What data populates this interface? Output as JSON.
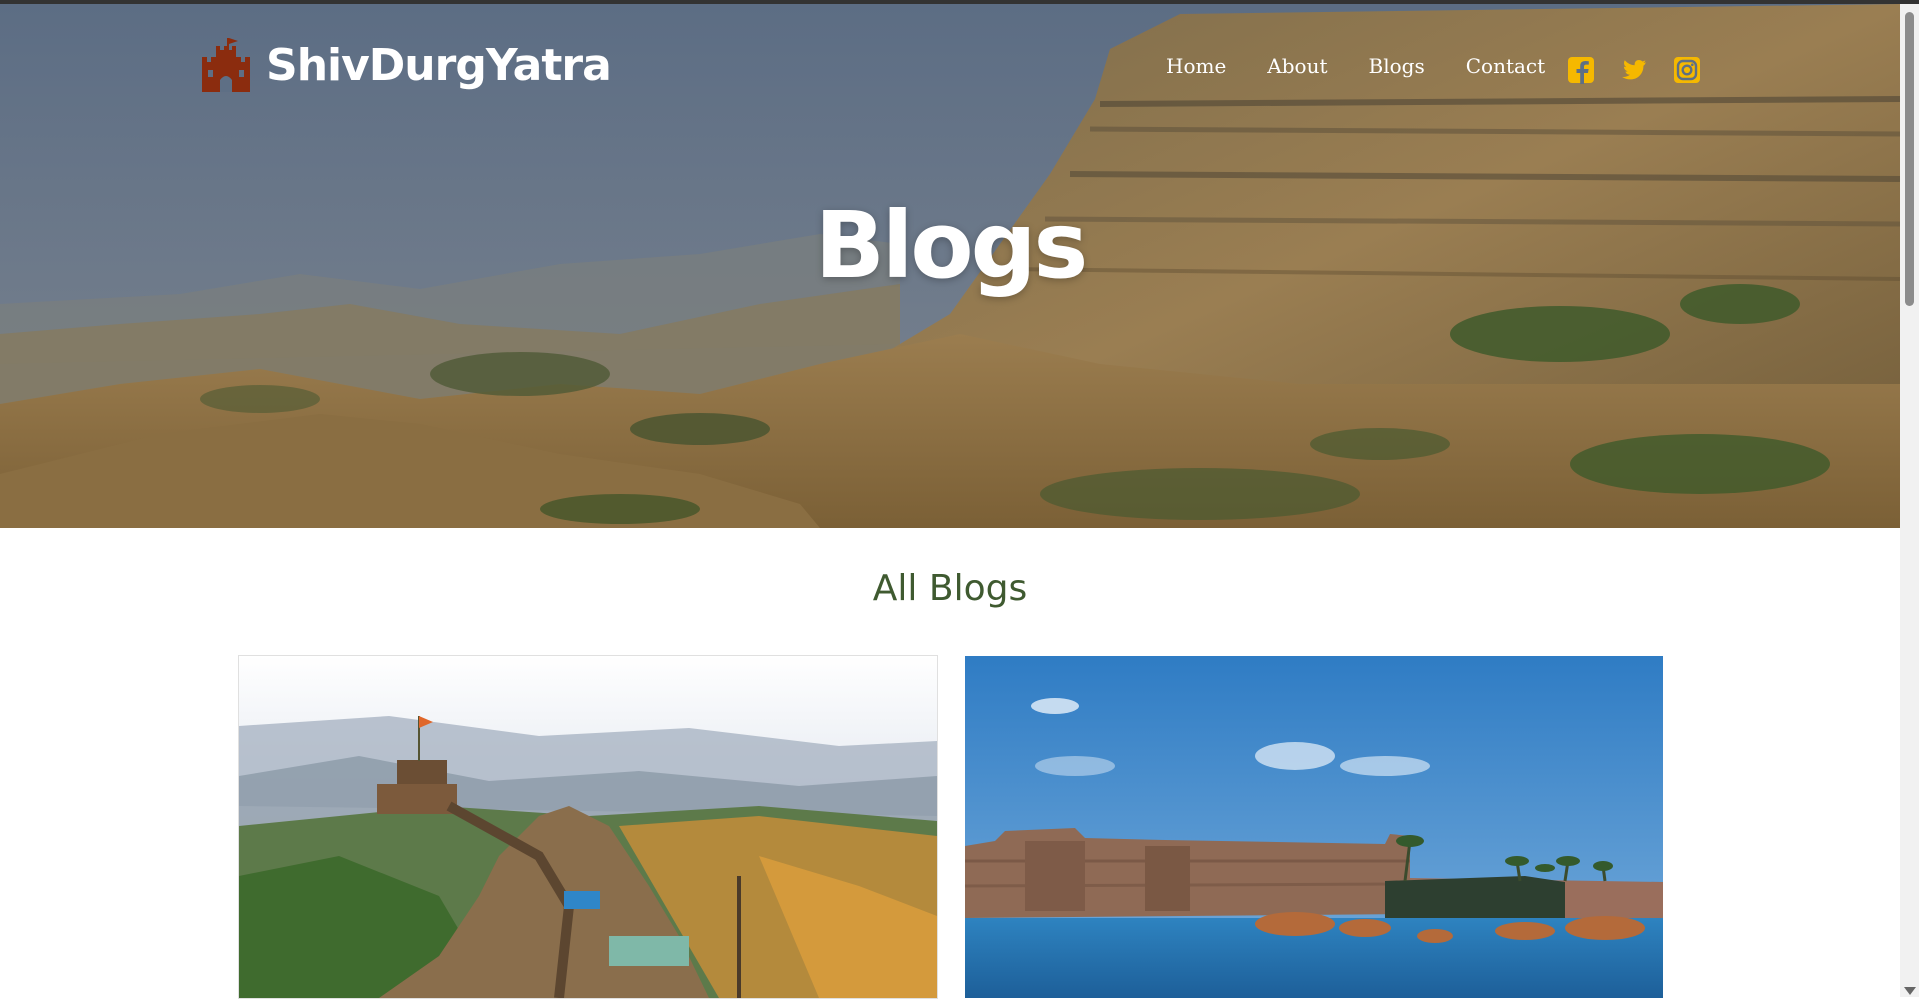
{
  "site": {
    "brand_name": "ShivDurgYatra",
    "logo_icon": "castle-icon",
    "logo_color": "#8b2c0e"
  },
  "nav": {
    "items": [
      "Home",
      "About",
      "Blogs",
      "Contact"
    ],
    "social_icons": [
      "facebook-icon",
      "twitter-icon",
      "instagram-icon"
    ],
    "social_color": "#f5b800"
  },
  "hero": {
    "title": "Blogs"
  },
  "section": {
    "title": "All Blogs",
    "title_color": "#3f5a30"
  },
  "cards": [
    {
      "image": "hill-fort-image"
    },
    {
      "image": "sea-fort-image"
    }
  ]
}
